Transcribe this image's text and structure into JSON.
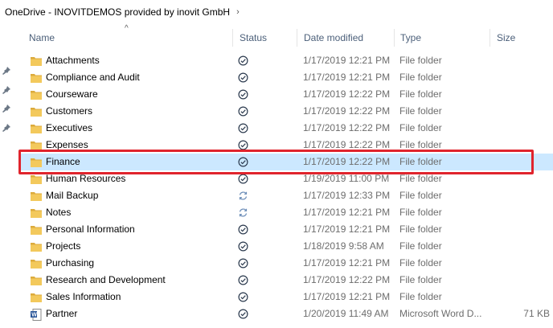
{
  "breadcrumb": {
    "path": "OneDrive - INOVITDEMOS provided by inovit GmbH",
    "chevron": "›"
  },
  "columns": {
    "name": "Name",
    "status": "Status",
    "date": "Date modified",
    "type": "Type",
    "size": "Size"
  },
  "sort_indicator": "^",
  "rows": [
    {
      "name": "Attachments",
      "status": "synced",
      "date": "1/17/2019 12:21 PM",
      "type": "File folder",
      "size": "",
      "icon": "folder-icon"
    },
    {
      "name": "Compliance and Audit",
      "status": "synced",
      "date": "1/17/2019 12:21 PM",
      "type": "File folder",
      "size": "",
      "icon": "folder-icon"
    },
    {
      "name": "Courseware",
      "status": "synced",
      "date": "1/17/2019 12:22 PM",
      "type": "File folder",
      "size": "",
      "icon": "folder-icon"
    },
    {
      "name": "Customers",
      "status": "synced",
      "date": "1/17/2019 12:22 PM",
      "type": "File folder",
      "size": "",
      "icon": "folder-icon"
    },
    {
      "name": "Executives",
      "status": "synced",
      "date": "1/17/2019 12:22 PM",
      "type": "File folder",
      "size": "",
      "icon": "folder-icon"
    },
    {
      "name": "Expenses",
      "status": "synced",
      "date": "1/17/2019 12:22 PM",
      "type": "File folder",
      "size": "",
      "icon": "folder-icon"
    },
    {
      "name": "Finance",
      "status": "synced",
      "date": "1/17/2019 12:22 PM",
      "type": "File folder",
      "size": "",
      "icon": "folder-icon",
      "selected": true
    },
    {
      "name": "Human Resources",
      "status": "synced",
      "date": "1/19/2019 11:00 PM",
      "type": "File folder",
      "size": "",
      "icon": "folder-icon"
    },
    {
      "name": "Mail Backup",
      "status": "syncing",
      "date": "1/17/2019 12:33 PM",
      "type": "File folder",
      "size": "",
      "icon": "folder-icon"
    },
    {
      "name": "Notes",
      "status": "syncing",
      "date": "1/17/2019 12:21 PM",
      "type": "File folder",
      "size": "",
      "icon": "folder-icon"
    },
    {
      "name": "Personal Information",
      "status": "synced",
      "date": "1/17/2019 12:21 PM",
      "type": "File folder",
      "size": "",
      "icon": "folder-icon"
    },
    {
      "name": "Projects",
      "status": "synced",
      "date": "1/18/2019 9:58 AM",
      "type": "File folder",
      "size": "",
      "icon": "folder-icon"
    },
    {
      "name": "Purchasing",
      "status": "synced",
      "date": "1/17/2019 12:21 PM",
      "type": "File folder",
      "size": "",
      "icon": "folder-icon"
    },
    {
      "name": "Research and Development",
      "status": "synced",
      "date": "1/17/2019 12:22 PM",
      "type": "File folder",
      "size": "",
      "icon": "folder-icon"
    },
    {
      "name": "Sales Information",
      "status": "synced",
      "date": "1/17/2019 12:21 PM",
      "type": "File folder",
      "size": "",
      "icon": "folder-icon"
    },
    {
      "name": "Partner",
      "status": "synced",
      "date": "1/20/2019 11:49 AM",
      "type": "Microsoft Word D...",
      "size": "71 KB",
      "icon": "word-document-icon"
    }
  ],
  "colors": {
    "header_text": "#4c607a",
    "selection": "#cce8ff",
    "highlight_border": "#e0242d",
    "folder": "#e8b84a"
  }
}
